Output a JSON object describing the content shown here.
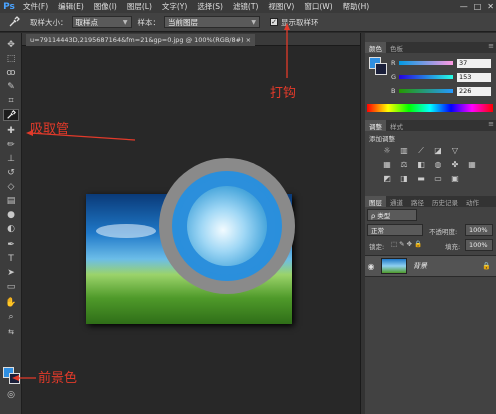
{
  "app": {
    "logo": "Ps"
  },
  "menu": [
    "文件(F)",
    "编辑(E)",
    "图像(I)",
    "图层(L)",
    "文字(Y)",
    "选择(S)",
    "滤镜(T)",
    "视图(V)",
    "窗口(W)",
    "帮助(H)"
  ],
  "window_controls": [
    "—",
    "□",
    "✕"
  ],
  "options": {
    "tool_icon": "eyedropper-icon",
    "sample_size_label": "取样大小：",
    "sample_size_value": "取样点",
    "sample_label": "样本：",
    "sample_value": "当前图层",
    "show_ring_checked": true,
    "show_ring_label": "显示取样环"
  },
  "document_tab": "u=79114443D,2195687164&fm=21&gp=0.jpg @ 100%(RGB/8#) ×",
  "annotations": {
    "eyedropper": "吸取管",
    "checkbox": "打钩",
    "foreground": "前景色"
  },
  "panels": {
    "color_tabs": [
      "颜色",
      "色板"
    ],
    "rgb": [
      {
        "channel": "R",
        "value": "37"
      },
      {
        "channel": "G",
        "value": "153"
      },
      {
        "channel": "B",
        "value": "226"
      }
    ],
    "foreground_color": "#2599e2",
    "adjust_tabs": [
      "调整",
      "样式"
    ],
    "adjust_title": "添加调整",
    "layers_tabs": [
      "图层",
      "通道",
      "路径",
      "历史记录",
      "动作"
    ],
    "kind_label": "ρ 类型",
    "blend_mode": "正常",
    "opacity_label": "不透明度:",
    "opacity_value": "100%",
    "lock_label": "锁定:",
    "fill_label": "填充:",
    "fill_value": "100%",
    "layer_name": "背景"
  }
}
